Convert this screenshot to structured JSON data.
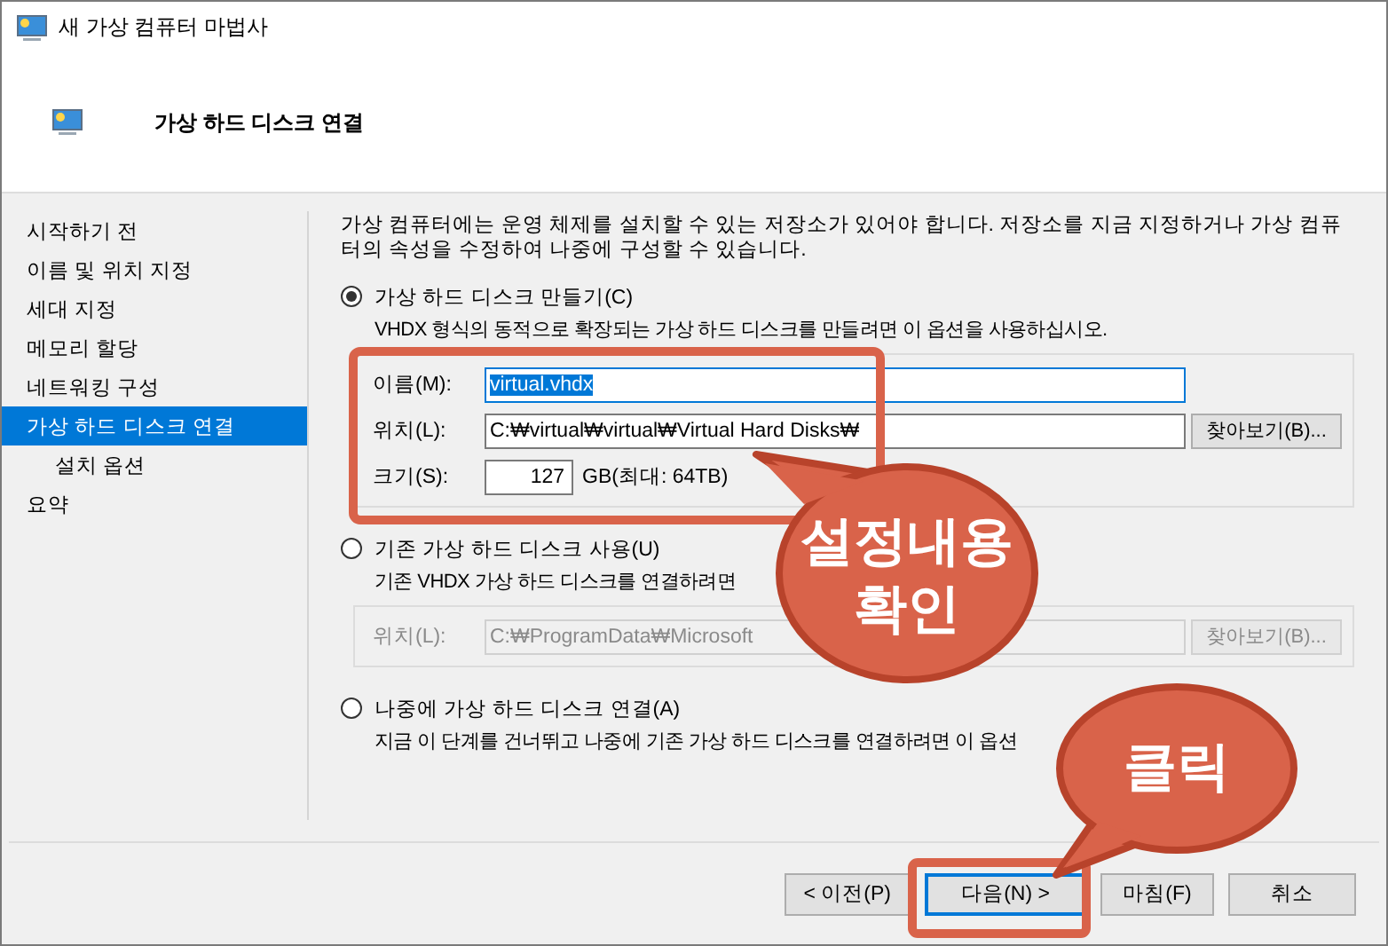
{
  "window": {
    "title": "새 가상 컴퓨터 마법사"
  },
  "header": {
    "title": "가상 하드 디스크 연결"
  },
  "steps": [
    {
      "label": "시작하기 전",
      "selected": false,
      "sub": false
    },
    {
      "label": "이름 및 위치 지정",
      "selected": false,
      "sub": false
    },
    {
      "label": "세대 지정",
      "selected": false,
      "sub": false
    },
    {
      "label": "메모리 할당",
      "selected": false,
      "sub": false
    },
    {
      "label": "네트워킹 구성",
      "selected": false,
      "sub": false
    },
    {
      "label": "가상 하드 디스크 연결",
      "selected": true,
      "sub": false
    },
    {
      "label": "설치 옵션",
      "selected": false,
      "sub": true
    },
    {
      "label": "요약",
      "selected": false,
      "sub": false
    }
  ],
  "description": "가상 컴퓨터에는 운영 체제를 설치할 수 있는 저장소가 있어야 합니다. 저장소를 지금 지정하거나 가상 컴퓨터의 속성을 수정하여 나중에 구성할 수 있습니다.",
  "options": [
    {
      "label": "가상 하드 디스크 만들기(C)",
      "selected": true,
      "hint": "VHDX 형식의 동적으로 확장되는 가상 하드 디스크를 만들려면 이 옵션을 사용하십시오.",
      "fields": [
        {
          "kind": "text",
          "label": "이름(M):",
          "value": "virtual.vhdx",
          "highlighted": true,
          "disabled": false
        },
        {
          "kind": "path",
          "label": "위치(L):",
          "value": "C:₩virtual₩virtual₩Virtual Hard Disks₩",
          "button": "찾아보기(B)...",
          "highlighted": false,
          "disabled": false
        },
        {
          "kind": "size",
          "label": "크기(S):",
          "value": "127",
          "unit": "GB(최대: 64TB)",
          "highlighted": false,
          "disabled": false
        }
      ]
    },
    {
      "label": "기존 가상 하드 디스크 사용(U)",
      "selected": false,
      "hint": "기존 VHDX 가상 하드 디스크를 연결하려면",
      "fields": [
        {
          "kind": "path",
          "label": "위치(L):",
          "value": "C:₩ProgramData₩Microsoft",
          "button": "찾아보기(B)...",
          "highlighted": false,
          "disabled": true
        }
      ]
    },
    {
      "label": "나중에 가상 하드 디스크 연결(A)",
      "selected": false,
      "hint": "지금 이 단계를 건너뛰고 나중에 기존 가상 하드 디스크를 연결하려면 이 옵션"
    }
  ],
  "buttons": [
    {
      "label": "< 이전(P)",
      "default": false
    },
    {
      "label": "다음(N) >",
      "default": true
    },
    {
      "label": "마침(F)",
      "default": false
    },
    {
      "label": "취소",
      "default": false
    }
  ],
  "callouts": [
    {
      "text": "설정내용 확인"
    },
    {
      "text": "클릭"
    }
  ]
}
